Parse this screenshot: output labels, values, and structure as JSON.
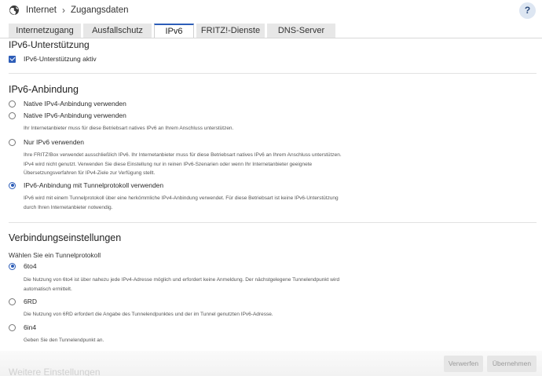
{
  "header": {
    "breadcrumb": [
      "Internet",
      "Zugangsdaten"
    ],
    "breadcrumb_separator": "›",
    "help_label": "?"
  },
  "tabs": [
    {
      "label": "Internetzugang",
      "active": false
    },
    {
      "label": "Ausfallschutz",
      "active": false
    },
    {
      "label": "IPv6",
      "active": true
    },
    {
      "label": "FRITZ!-Dienste",
      "active": false
    },
    {
      "label": "DNS-Server",
      "active": false
    }
  ],
  "support": {
    "title": "IPv6-Unterstützung",
    "checkbox_label": "IPv6-Unterstützung aktiv",
    "checked": true
  },
  "connection": {
    "title": "IPv6-Anbindung",
    "options": [
      {
        "label": "Native IPv4-Anbindung verwenden",
        "selected": false,
        "desc": ""
      },
      {
        "label": "Native IPv6-Anbindung verwenden",
        "selected": false,
        "desc": "Ihr Internetanbieter muss für diese Betriebsart natives IPv6 an Ihrem Anschluss unterstützen."
      },
      {
        "label": "Nur IPv6 verwenden",
        "selected": false,
        "desc": "Ihre FRITZ!Box verwendet ausschließlich IPv6. Ihr Internetanbieter muss für diese Betriebsart natives IPv6 an Ihrem Anschluss unterstützen. IPv4 wird nicht genutzt. Verwenden Sie diese Einstellung nur in reinen IPv6-Szenarien oder wenn Ihr Internetanbieter geeignete Übersetzungsverfahren für IPv4-Ziele zur Verfügung stellt."
      },
      {
        "label": "IPv6-Anbindung mit Tunnelprotokoll verwenden",
        "selected": true,
        "desc": "IPv6 wird mit einem Tunnelprotokoll über eine herkömmliche IPv4-Anbindung verwendet. Für diese Betriebsart ist keine IPv6-Unterstützung durch Ihren Internetanbieter notwendig."
      }
    ]
  },
  "settings": {
    "title": "Verbindungseinstellungen",
    "protocol_label": "Wählen Sie ein Tunnelprotokoll",
    "protocols": [
      {
        "label": "6to4",
        "selected": true,
        "desc": "Die Nutzung von 6to4 ist über nahezu jede IPv4-Adresse möglich und erfordert keine Anmeldung. Der nächstgelegene Tunnelendpunkt wird automatisch ermittelt."
      },
      {
        "label": "6RD",
        "selected": false,
        "desc": "Die Nutzung von 6RD erfordert die Angabe des Tunnelendpunktes und der im Tunnel genutzten IPv6-Adresse."
      },
      {
        "label": "6in4",
        "selected": false,
        "desc": "Geben Sie den Tunnelendpunkt an."
      }
    ]
  },
  "further_title": "Weitere Einstellungen",
  "buttons": {
    "discard": "Verwerfen",
    "apply": "Übernehmen"
  },
  "colors": {
    "accent": "#2d5db8",
    "tab_bg": "#e7e7e7",
    "button_bg": "#e6e6e6"
  },
  "icons": {
    "globe": "globe-icon",
    "help": "help-icon"
  }
}
